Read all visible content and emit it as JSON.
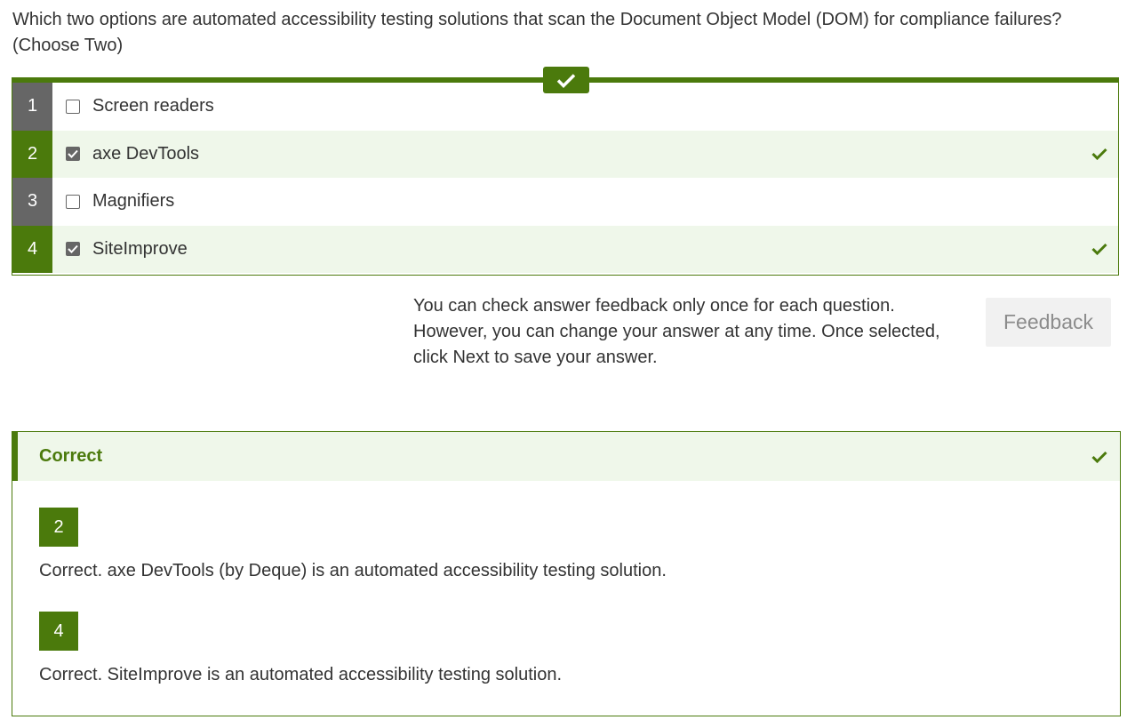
{
  "question": {
    "line1": "Which two options are automated accessibility testing solutions that scan the Document Object Model (DOM) for compliance failures?",
    "line2": "(Choose Two)"
  },
  "options": [
    {
      "number": "1",
      "label": "Screen readers",
      "checked": false
    },
    {
      "number": "2",
      "label": "axe DevTools",
      "checked": true
    },
    {
      "number": "3",
      "label": "Magnifiers",
      "checked": false
    },
    {
      "number": "4",
      "label": "SiteImprove",
      "checked": true
    }
  ],
  "note": {
    "line1": "You can check answer feedback only once for each question.",
    "line2": "However, you can change your answer at any time. Once selected,",
    "line3": "click Next to save your answer."
  },
  "feedback_button": {
    "label": "Feedback"
  },
  "result": {
    "title": "Correct",
    "items": [
      {
        "number": "2",
        "text": "Correct. axe DevTools (by Deque) is an automated accessibility testing solution."
      },
      {
        "number": "4",
        "text": "Correct. SiteImprove is an automated accessibility testing solution."
      }
    ]
  },
  "colors": {
    "accent": "#4b7a0c",
    "selected_bg": "#eff7ea",
    "unselected_num_bg": "#666666"
  },
  "icons": {
    "tab": "checkmark-icon",
    "row": "checkmark-icon",
    "result": "checkmark-icon"
  }
}
